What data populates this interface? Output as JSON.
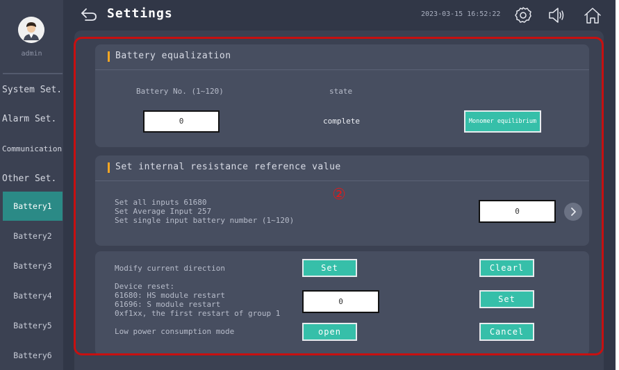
{
  "user": {
    "name": "admin"
  },
  "sidebar": {
    "items": [
      {
        "label": "System Set."
      },
      {
        "label": "Alarm Set."
      },
      {
        "label": "Communication"
      },
      {
        "label": "Other Set."
      }
    ],
    "sub_items": [
      {
        "label": "Battery1",
        "active": true
      },
      {
        "label": "Battery2"
      },
      {
        "label": "Battery3"
      },
      {
        "label": "Battery4"
      },
      {
        "label": "Battery5"
      },
      {
        "label": "Battery6"
      }
    ]
  },
  "header": {
    "title": "Settings",
    "datetime": "2023-03-15 16:52:22",
    "icons": [
      "back-arrow-icon",
      "gear-icon",
      "speaker-icon",
      "home-icon"
    ]
  },
  "equalization": {
    "title": "Battery equalization",
    "battery_no_label": "Battery No. (1~120)",
    "state_label": "state",
    "battery_no_value": "0",
    "state_value": "complete",
    "action_label": "Monomer equilibrium"
  },
  "resistance": {
    "title": "Set internal resistance reference value",
    "line1": "Set all inputs 61680",
    "line2": "Set Average Input 257",
    "line3": "Set single input battery number (1~120)",
    "value": "0"
  },
  "misc": {
    "direction_label": "Modify current direction",
    "direction_set": "Set",
    "clear_label": "Clearl",
    "reset_line1": "Device reset:",
    "reset_line2": "61680: HS module restart",
    "reset_line3": "61696: S module restart",
    "reset_line4": "0xf1xx, the first restart of group 1",
    "reset_value": "0",
    "reset_set": "Set",
    "lowpower_label": "Low power consumption mode",
    "open_label": "open",
    "cancel_label": "Cancel"
  },
  "annotation": {
    "number": "②"
  },
  "colors": {
    "accent": "#36bfa9",
    "active_nav": "#2b8a86",
    "section_bar": "#f5a623",
    "annotation": "#c81010"
  }
}
